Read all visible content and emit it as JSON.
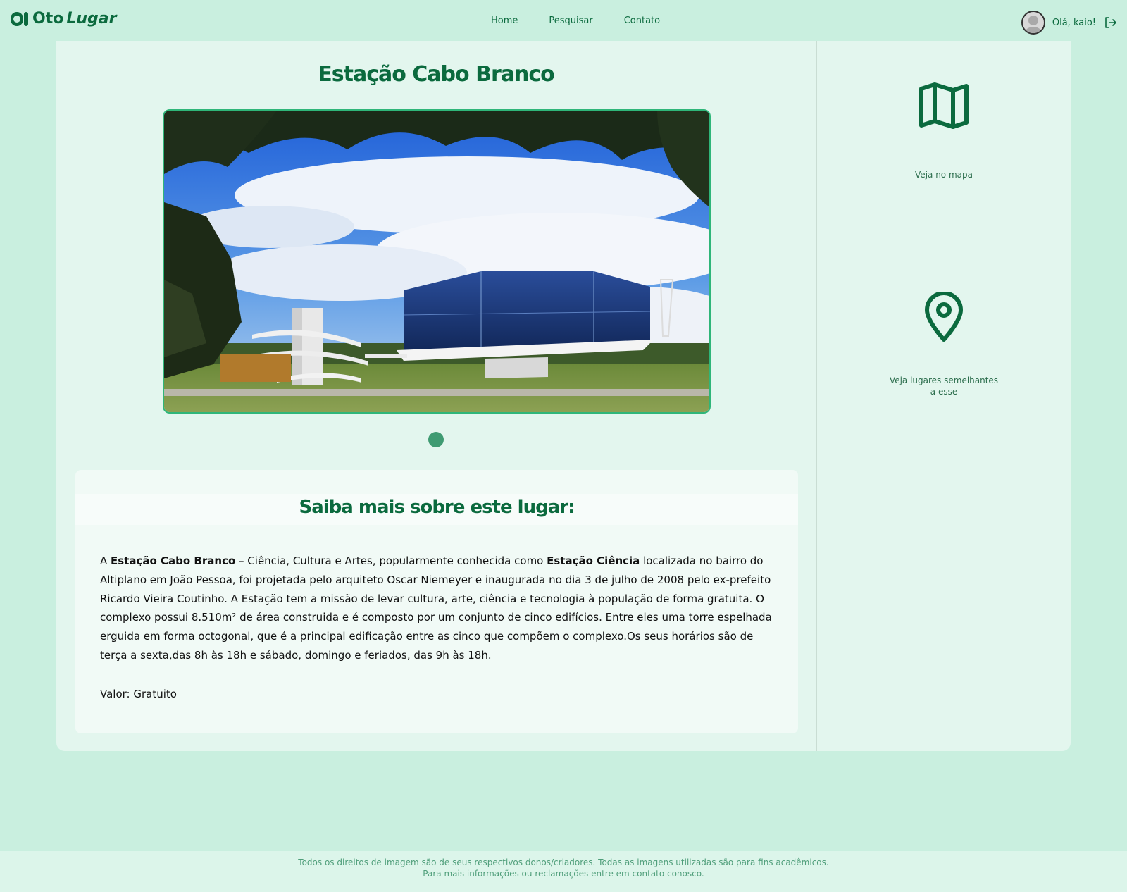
{
  "brand": {
    "name_part1": "Oto",
    "name_part2": "Lugar"
  },
  "nav": {
    "items": [
      "Home",
      "Pesquisar",
      "Contato"
    ]
  },
  "user": {
    "greeting": "Olá, kaio!"
  },
  "place": {
    "title": "Estação Cabo Branco",
    "info_title": "Saiba mais sobre este lugar:",
    "description": {
      "intro": "A ",
      "name": "Estação Cabo Branco",
      "after_name": " – Ciência, Cultura e Artes, popularmente conhecida como ",
      "nickname": "Estação Ciência",
      "rest": " localizada no bairro do Altiplano em João Pessoa, foi projetada pelo arquiteto Oscar Niemeyer e inaugurada no dia 3 de julho de 2008 pelo ex-prefeito Ricardo Vieira Coutinho. A Estação tem a missão de levar cultura, arte, ciência e tecnologia à população de forma gratuita. O complexo possui 8.510m² de área construida e é composto por um conjunto de cinco edifícios. Entre eles uma torre espelhada erguida em forma octogonal, que é a principal edificação entre as cinco que compõem o complexo.Os seus horários são de terça a sexta,das 8h às 18h e sábado, domingo e feriados, das 9h às 18h."
    },
    "value_text": "Valor: Gratuito"
  },
  "sidebar": {
    "map_label": "Veja no mapa",
    "similar_label": "Veja lugares semelhantes a esse"
  },
  "footer": {
    "line1": "Todos os direitos de imagem são de seus respectivos donos/criadores. Todas as imagens utilizadas são para fins acadêmicos.",
    "line2": "Para mais informações ou reclamações entre em contato conosco."
  },
  "colors": {
    "background": "#c9efdf",
    "panel": "#e3f6ee",
    "brand_green": "#0b6a3e",
    "carousel_dot": "#3f9b72"
  },
  "icons": [
    "logo-mark-icon",
    "logout-icon",
    "map-icon",
    "location-pin-icon",
    "avatar-icon"
  ]
}
